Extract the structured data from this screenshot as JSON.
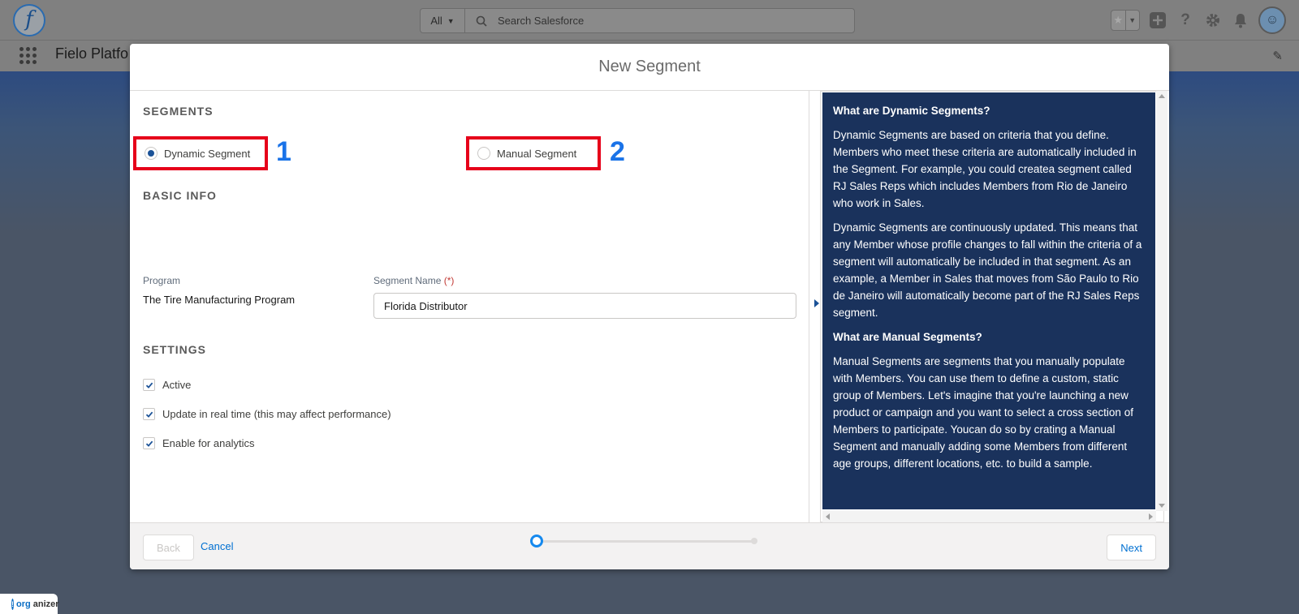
{
  "header": {
    "search_scope": "All",
    "search_placeholder": "Search Salesforce"
  },
  "nav": {
    "app_name": "Fielo Platfo"
  },
  "modal": {
    "title": "New Segment",
    "segments": {
      "section_title": "SEGMENTS",
      "option_dynamic": "Dynamic Segment",
      "option_manual": "Manual Segment",
      "selected": "Dynamic Segment",
      "annotation_1": "1",
      "annotation_2": "2"
    },
    "basic_info": {
      "section_title": "BASIC INFO",
      "program_label": "Program",
      "program_value": "The Tire Manufacturing Program",
      "segment_name_label": "Segment Name",
      "required_marker": "(*)",
      "segment_name_value": "Florida Distributor"
    },
    "settings": {
      "section_title": "SETTINGS",
      "active_label": "Active",
      "active_checked": true,
      "realtime_label": "Update in real time (this may affect performance)",
      "realtime_checked": true,
      "analytics_label": "Enable for analytics",
      "analytics_checked": true
    },
    "help": {
      "dynamic_heading": "What are Dynamic Segments?",
      "dynamic_p1": "Dynamic Segments are based on criteria that you define. Members who meet these criteria are automatically included in the Segment. For example, you could createa segment called RJ Sales Reps which includes Members from Rio de Janeiro who work in Sales.",
      "dynamic_p2": "Dynamic Segments are continuously updated. This means that any Member whose profile changes to fall within the criteria of a segment will automatically be included in that segment. As an example, a Member in Sales that moves from São Paulo to Rio de Janeiro will automatically become part of the RJ Sales Reps segment.",
      "manual_heading": "What are Manual Segments?",
      "manual_p1": "Manual Segments are segments that you manually populate with Members. You can use them to define a custom, static group of Members. Let's imagine that you're launching a new product or campaign and you want to select a cross section of Members to participate. Youcan do so by crating a Manual Segment and manually adding some Members from different age groups, different locations, etc. to build a sample.",
      "panel_color": "#1a325c"
    },
    "footer": {
      "back_label": "Back",
      "cancel_label": "Cancel",
      "next_label": "Next",
      "progress_step": 1,
      "progress_total": 2
    }
  },
  "badge": {
    "text_prefix": "org",
    "text_suffix": "anizer"
  },
  "colors": {
    "accent": "#0070d2",
    "highlight_box": "#e6001a",
    "annotation": "#1a73e8"
  }
}
